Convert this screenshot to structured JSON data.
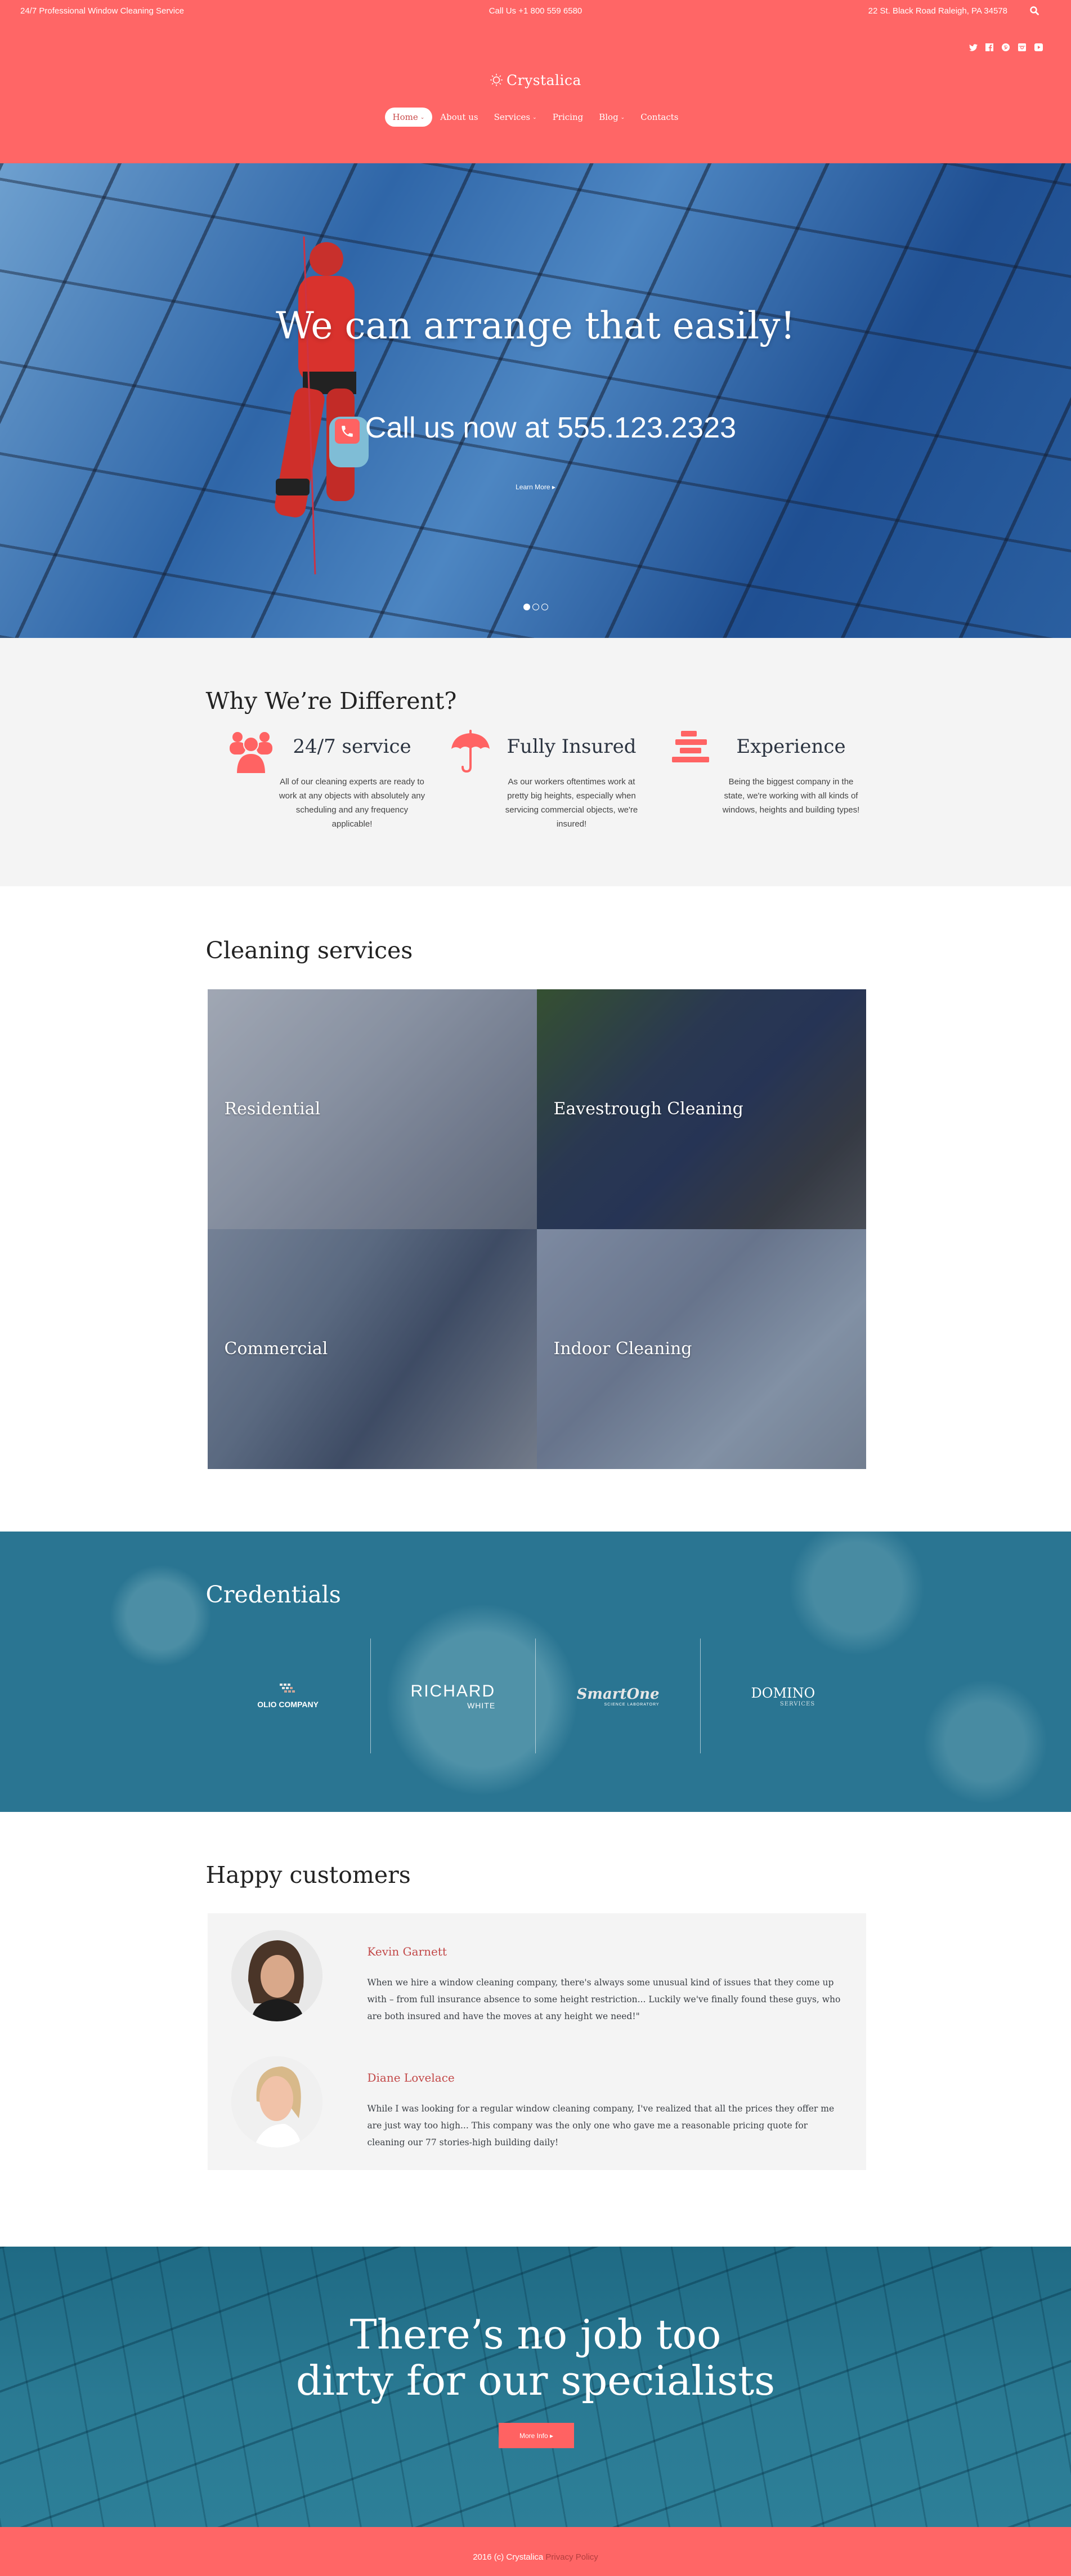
{
  "topbar": {
    "tagline": "24/7 Professional Window Cleaning Service",
    "phone": "Call Us +1 800 559 6580",
    "address": "22 St. Black Road Raleigh, PA 34578",
    "search_icon": "search-icon"
  },
  "social": [
    "twitter-icon",
    "facebook-icon",
    "pinterest-icon",
    "instagram-icon",
    "youtube-icon"
  ],
  "brand": {
    "name": "Crystalica",
    "icon": "sun-icon"
  },
  "nav": [
    {
      "label": "Home",
      "dropdown": true,
      "active": true
    },
    {
      "label": "About us",
      "dropdown": false
    },
    {
      "label": "Services",
      "dropdown": true
    },
    {
      "label": "Pricing",
      "dropdown": false
    },
    {
      "label": "Blog",
      "dropdown": true
    },
    {
      "label": "Contacts",
      "dropdown": false
    }
  ],
  "hero": {
    "title": "We can arrange that easily!",
    "call": "Call us now at 555.123.2323",
    "learn_more": "Learn More",
    "slides": 3,
    "active_slide": 1
  },
  "why": {
    "title": "Why We’re Different?",
    "features": [
      {
        "icon": "users-icon",
        "title": "24/7 service",
        "text": "All of our cleaning experts are ready to work at any objects with absolutely any scheduling and any frequency applicable!"
      },
      {
        "icon": "umbrella-icon",
        "title": "Fully Insured",
        "text": "As our workers oftentimes work at pretty big heights, especially when servicing commercial objects, we're insured!"
      },
      {
        "icon": "stack-icon",
        "title": "Experience",
        "text": "Being the biggest company in the state, we're working with all kinds of windows, heights and building types!"
      }
    ]
  },
  "services": {
    "title": "Cleaning services",
    "items": [
      "Residential",
      "Eavestrough Cleaning",
      "Commercial",
      "Indoor Cleaning"
    ]
  },
  "credentials": {
    "title": "Credentials",
    "logos": [
      {
        "main": "OLIO COMPANY",
        "sub": ""
      },
      {
        "main": "RICHARD",
        "sub": "WHITE"
      },
      {
        "main": "SmartOne",
        "sub": "SCIENCE LABORATORY"
      },
      {
        "main": "DOMINO",
        "sub": "SERVICES"
      }
    ]
  },
  "testimonials": {
    "title": "Happy customers",
    "items": [
      {
        "name": "Kevin Garnett",
        "text": "When we hire a window cleaning company, there's always some unusual kind of issues that they come up with – from full insurance absence to some height restriction... Luckily we've finally found these guys, who are both insured and have the moves at any height we need!\""
      },
      {
        "name": "Diane Lovelace",
        "text": "While I was looking for a regular window cleaning company, I've realized that all the prices they offer me are just way too high... This company was the only one who gave me a reasonable pricing quote for cleaning our 77 stories-high building daily!"
      }
    ]
  },
  "cta": {
    "line1": "There’s no job too",
    "line2": "dirty for our specialists",
    "button": "More Info"
  },
  "footer": {
    "copyright": "2016 (c) Crystalica",
    "privacy": "Privacy Policy"
  },
  "colors": {
    "accent": "#ff6666",
    "teal": "#2a7592",
    "name_red": "#c24848",
    "light_bg": "#f4f4f4"
  }
}
